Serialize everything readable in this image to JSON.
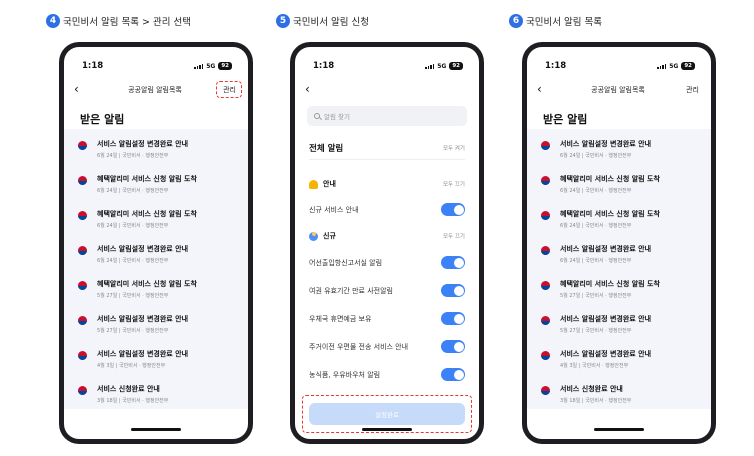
{
  "steps": [
    {
      "num": "4",
      "caption": "국민비서 알림 목록 > 관리 선택"
    },
    {
      "num": "5",
      "caption": "국민비서 알림 신청"
    },
    {
      "num": "6",
      "caption": "국민비서 알림 목록"
    }
  ],
  "status": {
    "time": "1:18",
    "network": "5G",
    "battery": "92"
  },
  "list_screen": {
    "nav_title": "공공알림 알림목록",
    "manage_label": "관리",
    "section_title": "받은 알림",
    "items": [
      {
        "title": "서비스 알림설정 변경완료 안내",
        "meta": "6월 24일 | 국민비서 · 행정안전부"
      },
      {
        "title": "혜택알리미 서비스 신청 알림 도착",
        "meta": "6월 24일 | 국민비서 · 행정안전부"
      },
      {
        "title": "혜택알리미 서비스 신청 알림 도착",
        "meta": "6월 24일 | 국민비서 · 행정안전부"
      },
      {
        "title": "서비스 알림설정 변경완료 안내",
        "meta": "6월 24일 | 국민비서 · 행정안전부"
      },
      {
        "title": "혜택알리미 서비스 신청 알림 도착",
        "meta": "5월 27일 | 국민비서 · 행정안전부"
      },
      {
        "title": "서비스 알림설정 변경완료 안내",
        "meta": "5월 27일 | 국민비서 · 행정안전부"
      },
      {
        "title": "서비스 알림설정 변경완료 안내",
        "meta": "4월 3일 | 국민비서 · 행정안전부"
      },
      {
        "title": "서비스 신청완료 안내",
        "meta": "3월 18일 | 국민비서 · 행정안전부"
      }
    ]
  },
  "settings_screen": {
    "search_placeholder": "알림 찾기",
    "all_label": "전체 알림",
    "all_action": "모두 켜기",
    "category_notice": "안내",
    "category_notice_action": "모두 끄기",
    "notice_items": [
      {
        "label": "신규 서비스 안내",
        "on": true
      }
    ],
    "category_new": "신규",
    "category_new_action": "모두 끄기",
    "new_items": [
      {
        "label": "어선출입항신고서실 알림",
        "on": true
      },
      {
        "label": "여권 유효기간 만료 사전알림",
        "on": true
      },
      {
        "label": "우체국 휴면예금 보유",
        "on": true
      },
      {
        "label": "주거이전 우편물 전송 서비스 안내",
        "on": true
      },
      {
        "label": "농식품, 우유바우처 알림",
        "on": true
      }
    ],
    "apply_label": "설정완료"
  },
  "colors": {
    "accent": "#2f6fe4",
    "toggle_on": "#3b82f6",
    "highlight": "#e53935"
  }
}
